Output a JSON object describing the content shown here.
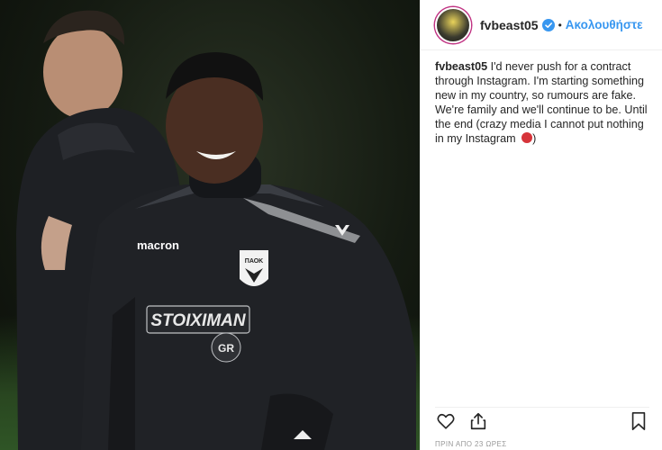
{
  "header": {
    "username": "fvbeast05",
    "separator": "•",
    "follow_label": "Ακολουθήστε"
  },
  "caption": {
    "username": "fvbeast05",
    "text": "I'd never push for a contract through Instagram. I'm starting something new in my country, so rumours are fake. We're family and we'll continue to be. Until the end (crazy media I cannot put nothing in my Instagram",
    "closing": ")"
  },
  "photo": {
    "jersey_sponsor": "STOIXIMAN",
    "jersey_sponsor_sub": "GR",
    "jersey_brand": "macron",
    "crest_text": "ΠΑΟΚ"
  },
  "timestamp": "ΠΡΙΝ ΑΠΟ 23 ΩΡΕΣ",
  "colors": {
    "link": "#3897f0",
    "verified": "#3897f0",
    "text": "#262626",
    "muted": "#999999"
  },
  "icons": [
    "heart-icon",
    "share-icon",
    "bookmark-icon",
    "verified-badge-icon"
  ]
}
